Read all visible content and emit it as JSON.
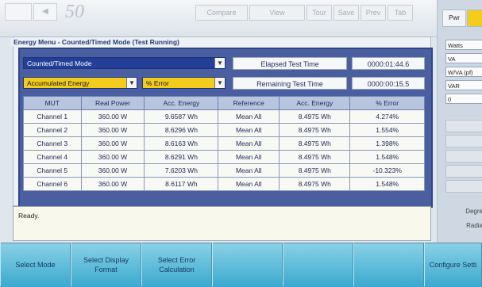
{
  "header": {
    "logo_text": "50",
    "buttons": [
      "Compare",
      "View",
      "Tour",
      "Save",
      "Prev",
      "Tab"
    ]
  },
  "panel": {
    "title": "Energy Menu - Counted/Timed Mode (Test Running)",
    "mode_select": "Counted/Timed Mode",
    "energy_select": "Accumulated Energy",
    "error_select": "% Error",
    "elapsed_label": "Elapsed Test Time",
    "elapsed_value": "0000:01:44.6",
    "remaining_label": "Remaining Test Time",
    "remaining_value": "0000:00:15.5"
  },
  "table": {
    "headers": [
      "MUT",
      "Real Power",
      "Acc. Energy",
      "Reference",
      "Acc. Energy",
      "% Error"
    ],
    "rows": [
      [
        "Channel 1",
        "360.00 W",
        "9.6587 Wh",
        "Mean All",
        "8.4975 Wh",
        "4.274%"
      ],
      [
        "Channel 2",
        "360.00 W",
        "8.6296 Wh",
        "Mean All",
        "8.4975 Wh",
        "1.554%"
      ],
      [
        "Channel 3",
        "360.00 W",
        "8.6163 Wh",
        "Mean All",
        "8.4975 Wh",
        "1.398%"
      ],
      [
        "Channel 4",
        "360.00 W",
        "8.6291 Wh",
        "Mean All",
        "8.4975 Wh",
        "1.548%"
      ],
      [
        "Channel 5",
        "360.00 W",
        "7.6203 Wh",
        "Mean All",
        "8.4975 Wh",
        "-10.323%"
      ],
      [
        "Channel 6",
        "360.00 W",
        "8.6117 Wh",
        "Mean All",
        "8.4975 Wh",
        "1.548%"
      ]
    ]
  },
  "status": {
    "text": "Ready."
  },
  "right_panel": {
    "tabs": [
      "Pwr",
      ""
    ],
    "inputs": [
      "Watts",
      "VA",
      "W/VA (pf)",
      "VAR",
      "0"
    ],
    "labels": [
      "Degre",
      "Radia"
    ]
  },
  "function_keys": [
    "Select Mode",
    "Select Display Format",
    "Select Error Calculation",
    "",
    "",
    "",
    "Configure Setti"
  ],
  "colors": {
    "panel_border": "#2f4587",
    "mode_bg": "#233f98",
    "highlight": "#f2cd1e",
    "bottom_bar": "#56b8dc"
  }
}
